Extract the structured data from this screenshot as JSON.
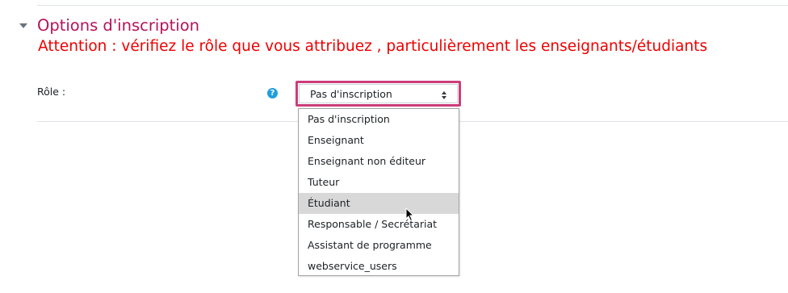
{
  "section": {
    "title": "Options d'inscription",
    "warning": "Attention : vérifiez le rôle que vous attribuez , particulièrement les enseignants/étudiants"
  },
  "role_field": {
    "label": "Rôle :",
    "help_icon": "question-circle-icon",
    "help_symbol": "?",
    "selected_value": "Pas d'inscription",
    "options": [
      "Pas d'inscription",
      "Enseignant",
      "Enseignant non éditeur",
      "Tuteur",
      "Étudiant",
      "Responsable / Secrétariat",
      "Assistant de programme",
      "webservice_users"
    ],
    "hovered_option": "Étudiant"
  },
  "colors": {
    "title": "#b5125a",
    "warning": "#ee0000",
    "focus_border": "#cc3d7a",
    "help_icon": "#1f9fdc",
    "hover_bg": "#d8d8d8"
  }
}
